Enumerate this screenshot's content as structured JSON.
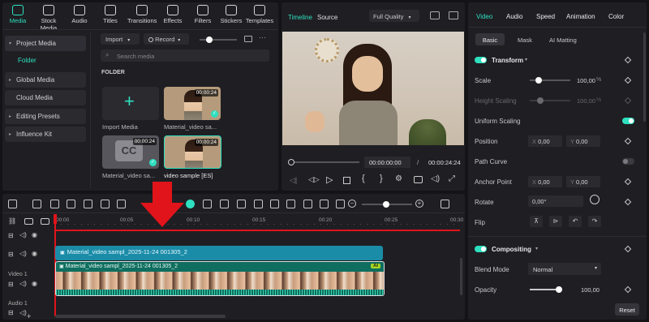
{
  "top_tabs": [
    {
      "label": "Media",
      "icon": "media-icon"
    },
    {
      "label": "Stock Media",
      "icon": "stock-media-icon"
    },
    {
      "label": "Audio",
      "icon": "audio-icon"
    },
    {
      "label": "Titles",
      "icon": "titles-icon"
    },
    {
      "label": "Transitions",
      "icon": "transitions-icon"
    },
    {
      "label": "Effects",
      "icon": "effects-icon"
    },
    {
      "label": "Filters",
      "icon": "filters-icon"
    },
    {
      "label": "Stickers",
      "icon": "stickers-icon"
    },
    {
      "label": "Templates",
      "icon": "templates-icon"
    }
  ],
  "sidebar": {
    "items": [
      "Project Media",
      "Folder",
      "Global Media",
      "Cloud Media",
      "Editing Presets",
      "Influence Kit"
    ]
  },
  "media": {
    "import_label": "Import",
    "record_label": "Record",
    "search_placeholder": "Search media",
    "folder_heading": "FOLDER",
    "import_tile_label": "Import Media",
    "clips": [
      {
        "name": "Material_video sa...",
        "duration": "00:00:24"
      },
      {
        "name": "Material_video sa...",
        "duration": "00:00:24"
      },
      {
        "name": "video sample [ES]",
        "duration": "00:00:24"
      }
    ],
    "cc_label": "CC"
  },
  "preview": {
    "tab_timeline": "Timeline",
    "tab_source": "Source",
    "quality": "Full Quality",
    "current_time": "00:00:00:00",
    "separator": "/",
    "total_time": "00:00:24:24"
  },
  "timeline": {
    "ruler": [
      "00:00",
      "00:05",
      "00:10",
      "00:15",
      "00:20",
      "00:25",
      "00:30"
    ],
    "title_clip": "Material_video sampl_2025-11-24 001305_2",
    "video_clip": "Material_video sampl_2025-11-24 001305_2",
    "ai_badge": "AI",
    "video_track_label": "Video 1",
    "audio_track_label": "Audio 1"
  },
  "inspector": {
    "tabs": [
      "Video",
      "Audio",
      "Speed",
      "Animation",
      "Color"
    ],
    "subtabs": [
      "Basic",
      "Mask",
      "AI Matting"
    ],
    "transform_heading": "Transform",
    "scale_label": "Scale",
    "scale_value": "100,00",
    "scale_unit": "%",
    "scale_level": 0.18,
    "height_label": "Height Scaling",
    "height_value": "100,00",
    "height_unit": "%",
    "uniform_label": "Uniform Scaling",
    "position_label": "Position",
    "pos_x_axis": "X",
    "pos_x": "0,00",
    "pos_y_axis": "Y",
    "pos_y": "0,00",
    "path_label": "Path Curve",
    "anchor_label": "Anchor Point",
    "anc_x_axis": "X",
    "anc_x": "0,00",
    "anc_y_axis": "Y",
    "anc_y": "0,00",
    "rotate_label": "Rotate",
    "rotate_value": "0,00°",
    "flip_label": "Flip",
    "compositing_heading": "Compositing",
    "blend_label": "Blend Mode",
    "blend_value": "Normal",
    "opacity_label": "Opacity",
    "opacity_value": "100,00",
    "reset_label": "Reset"
  },
  "colors": {
    "accent": "#2ee0c0",
    "arrow": "#e0141a",
    "title_clip": "#1b8ca8",
    "video_clip": "#0f6e5f"
  }
}
